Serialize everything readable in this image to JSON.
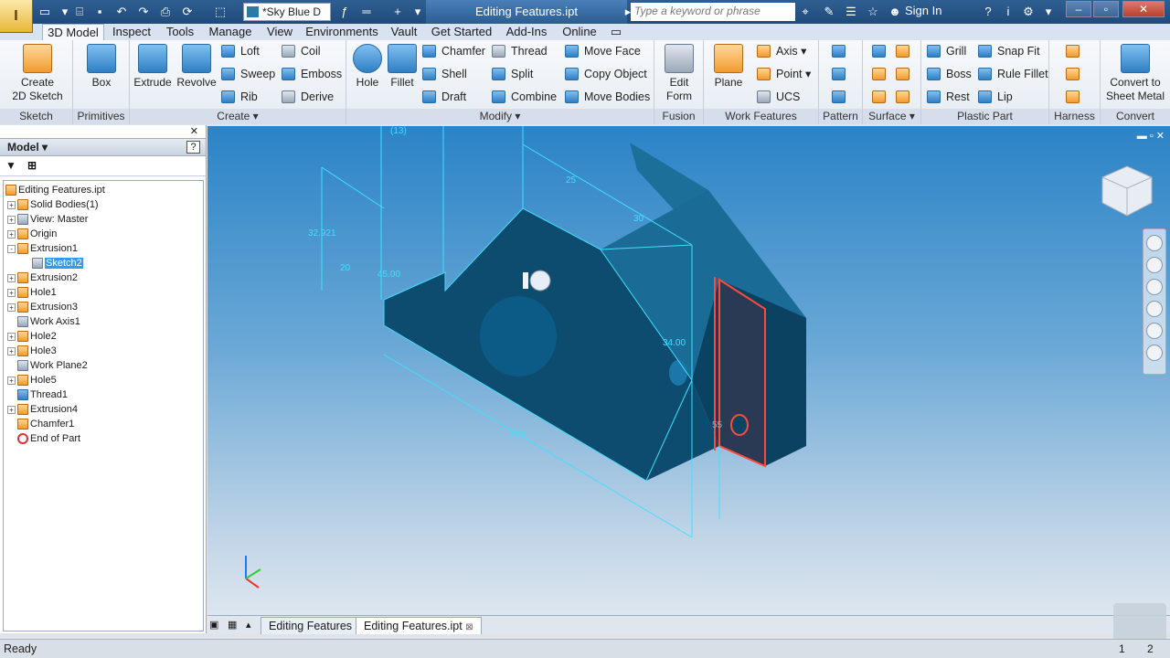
{
  "app": {
    "logo_label": "I",
    "title": "Editing Features.ipt"
  },
  "quick_access": {
    "appearance_value": "*Sky Blue D",
    "search_placeholder": "Type a keyword or phrase",
    "sign_in": "Sign In"
  },
  "tabs": [
    "3D Model",
    "Inspect",
    "Tools",
    "Manage",
    "View",
    "Environments",
    "Vault",
    "Get Started",
    "Add-Ins",
    "Online"
  ],
  "ribbon": {
    "sketch": {
      "create": "Create\n2D Sketch",
      "label": "Sketch"
    },
    "primitives": {
      "box": "Box",
      "label": "Primitives"
    },
    "create": {
      "extrude": "Extrude",
      "revolve": "Revolve",
      "loft": "Loft",
      "sweep": "Sweep",
      "rib": "Rib",
      "coil": "Coil",
      "emboss": "Emboss",
      "derive": "Derive",
      "label": "Create"
    },
    "modify": {
      "hole": "Hole",
      "fillet": "Fillet",
      "chamfer": "Chamfer",
      "shell": "Shell",
      "draft": "Draft",
      "thread": "Thread",
      "split": "Split",
      "combine": "Combine",
      "move_face": "Move Face",
      "copy_object": "Copy Object",
      "move_bodies": "Move Bodies",
      "label": "Modify"
    },
    "fusion": {
      "edit_form": "Edit\nForm",
      "label": "Fusion"
    },
    "work_features": {
      "plane": "Plane",
      "axis": "Axis",
      "point": "Point",
      "ucs": "UCS",
      "label": "Work Features"
    },
    "pattern": {
      "label": "Pattern"
    },
    "surface": {
      "label": "Surface"
    },
    "plastic_part": {
      "grill": "Grill",
      "boss": "Boss",
      "rest": "Rest",
      "snap_fit": "Snap Fit",
      "rule_fillet": "Rule Fillet",
      "lip": "Lip",
      "label": "Plastic Part"
    },
    "harness": {
      "label": "Harness"
    },
    "convert": {
      "convert": "Convert to\nSheet Metal",
      "label": "Convert"
    }
  },
  "browser": {
    "title": "Model",
    "help": "?",
    "nodes": [
      {
        "label": "Editing Features.ipt",
        "expand": ""
      },
      {
        "label": "Solid Bodies(1)",
        "expand": "+"
      },
      {
        "label": "View: Master",
        "expand": "+"
      },
      {
        "label": "Origin",
        "expand": "+"
      },
      {
        "label": "Extrusion1",
        "expand": "-"
      },
      {
        "label": "Sketch2",
        "expand": ""
      },
      {
        "label": "Extrusion2",
        "expand": "+"
      },
      {
        "label": "Hole1",
        "expand": "+"
      },
      {
        "label": "Extrusion3",
        "expand": "+"
      },
      {
        "label": "Work Axis1",
        "expand": ""
      },
      {
        "label": "Hole2",
        "expand": "+"
      },
      {
        "label": "Hole3",
        "expand": "+"
      },
      {
        "label": "Work Plane2",
        "expand": ""
      },
      {
        "label": "Hole5",
        "expand": "+"
      },
      {
        "label": "Thread1",
        "expand": ""
      },
      {
        "label": "Extrusion4",
        "expand": "+"
      },
      {
        "label": "Chamfer1",
        "expand": ""
      },
      {
        "label": "End of Part",
        "expand": ""
      }
    ]
  },
  "viewport": {
    "dims": [
      "(13)",
      "25",
      "30",
      "32.921",
      "20",
      "45.00",
      "34.00",
      "55",
      "100"
    ]
  },
  "doc_tabs": [
    "Editing Features",
    "Editing Features.ipt"
  ],
  "status": {
    "text": "Ready",
    "n1": "1",
    "n2": "2"
  },
  "colors": {
    "title_bar": "#2f5f92",
    "model_blue": "#0f4f73",
    "sketch_cyan": "#3fe0ff",
    "highlight_red": "#ff4a3a"
  }
}
